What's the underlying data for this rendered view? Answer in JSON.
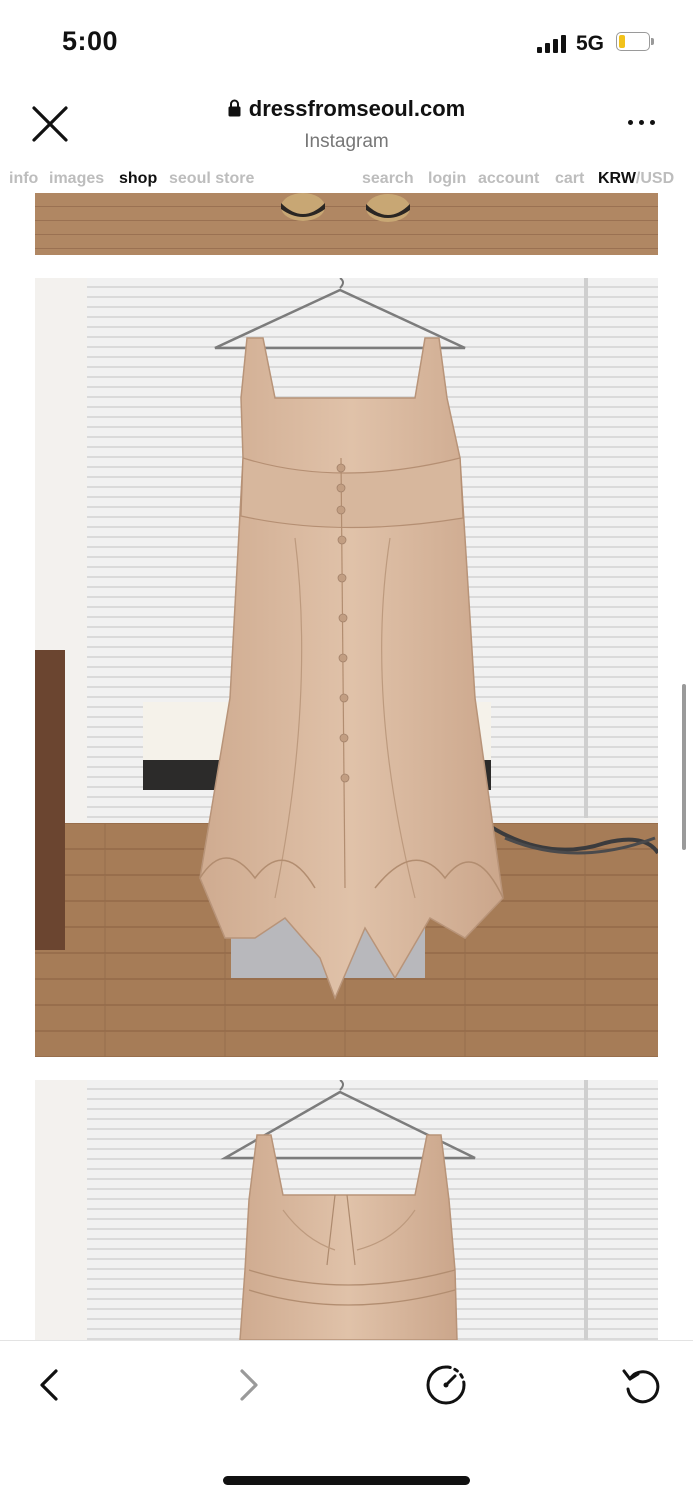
{
  "status": {
    "time": "5:00",
    "network": "5G"
  },
  "browser": {
    "url": "dressfromseoul.com",
    "source": "Instagram",
    "icons": {
      "close": "close-icon",
      "lock": "lock-icon",
      "more": "more-icon"
    }
  },
  "nav": {
    "left": [
      "info",
      "images",
      "shop",
      "seoul store"
    ],
    "right": [
      "search",
      "login",
      "account",
      "cart"
    ],
    "active": "shop",
    "currency_active": "KRW",
    "currency_sep": "/",
    "currency_other": "USD"
  },
  "product": {
    "description": "beige cotton sleeveless dress on hanger",
    "colors": {
      "dress": "#d9b9a0",
      "floor": "#a97f5c",
      "blinds": "#ececec"
    }
  },
  "toolbar": {
    "icons": [
      "back-arrow-icon",
      "forward-arrow-icon",
      "speed-icon",
      "refresh-icon"
    ]
  }
}
